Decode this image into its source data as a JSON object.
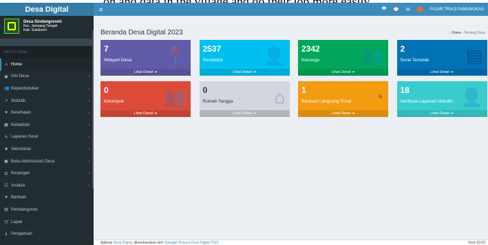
{
  "top_strip": "on and data in the village and do their job more easily.",
  "brand": "Desa Digital",
  "village": {
    "line1": "Desa Sindangresmi",
    "line2": "Kec. Jampang Tengah",
    "line3": "Kab. Sukabumi"
  },
  "menu_header": "MENU UTAMA",
  "nav": [
    {
      "label": "Home",
      "icon": "⌂",
      "active": true,
      "chev": false
    },
    {
      "label": "Info Desa",
      "icon": "◉",
      "chev": true
    },
    {
      "label": "Kependudukan",
      "icon": "👥",
      "chev": true
    },
    {
      "label": "Statistik",
      "icon": "↗",
      "chev": true
    },
    {
      "label": "Kesehatan",
      "icon": "♥",
      "chev": true
    },
    {
      "label": "Kehadiran",
      "icon": "▦",
      "chev": true
    },
    {
      "label": "Layanan Surat",
      "icon": "✎",
      "chev": true
    },
    {
      "label": "Sekretariat",
      "icon": "■",
      "chev": true
    },
    {
      "label": "Buku Administrasi Desa",
      "icon": "▣",
      "chev": true
    },
    {
      "label": "Keuangan",
      "icon": "⚖",
      "chev": true
    },
    {
      "label": "Analisis",
      "icon": "☑",
      "chev": true
    },
    {
      "label": "Bantuan",
      "icon": "♥",
      "chev": false
    },
    {
      "label": "Pembangunan",
      "icon": "▥",
      "chev": false
    },
    {
      "label": "Lapak",
      "icon": "🛒",
      "chev": false
    },
    {
      "label": "Pengaduan",
      "icon": "ℹ",
      "chev": false
    }
  ],
  "chevron": "‹",
  "header": {
    "hamburger": "≡",
    "print": "🖶",
    "chat": "💬",
    "mail": "✉",
    "user": "FAJAR TRIAJI PAMUNGKAS"
  },
  "page_title": "Beranda Desa Digital 2023",
  "breadcrumb": {
    "home": "Home",
    "sep": "›",
    "current": "Tentang Desa"
  },
  "boxes": [
    {
      "num": "7",
      "label": "Wilayah Desa",
      "footer": "Lihat Detail ➔",
      "color": "#605ca8",
      "icon": "📍"
    },
    {
      "num": "2537",
      "label": "Penduduk",
      "footer": "Lihat Detail ➔",
      "color": "#00c0ef",
      "icon": "👤"
    },
    {
      "num": "2342",
      "label": "Keluarga",
      "footer": "Lihat Detail ➔",
      "color": "#00a65a",
      "icon": "👥"
    },
    {
      "num": "2",
      "label": "Surat Tercetak",
      "footer": "Lihat Detail ➔",
      "color": "#0073b7",
      "icon": "▤"
    },
    {
      "num": "0",
      "label": "Kelompok",
      "footer": "Lihat Detail ➔",
      "color": "#dd4b39",
      "icon": "👥"
    },
    {
      "num": "0",
      "label": "Rumah Tangga",
      "footer": "Lihat Detail ➔",
      "color": "#d2d6de",
      "icon": "⌂",
      "dark": true
    },
    {
      "num": "1",
      "label": "Bantuan Langsung Tunai",
      "footer": "Lihat Detail ➔",
      "color": "#f39c12",
      "icon": "◔"
    },
    {
      "num": "18",
      "label": "Verifikasi Layanan Mandiri",
      "footer": "Lihat Detail ➔",
      "color": "#39cccc",
      "icon": "👤"
    }
  ],
  "footer": {
    "prefix": "Aplikasi",
    "app": "Desa Digital",
    "middle": ", dikembangkan oleh",
    "dev": "Sanggar Pesona Desa Digital 2023",
    "version": "Versi 23.03"
  }
}
